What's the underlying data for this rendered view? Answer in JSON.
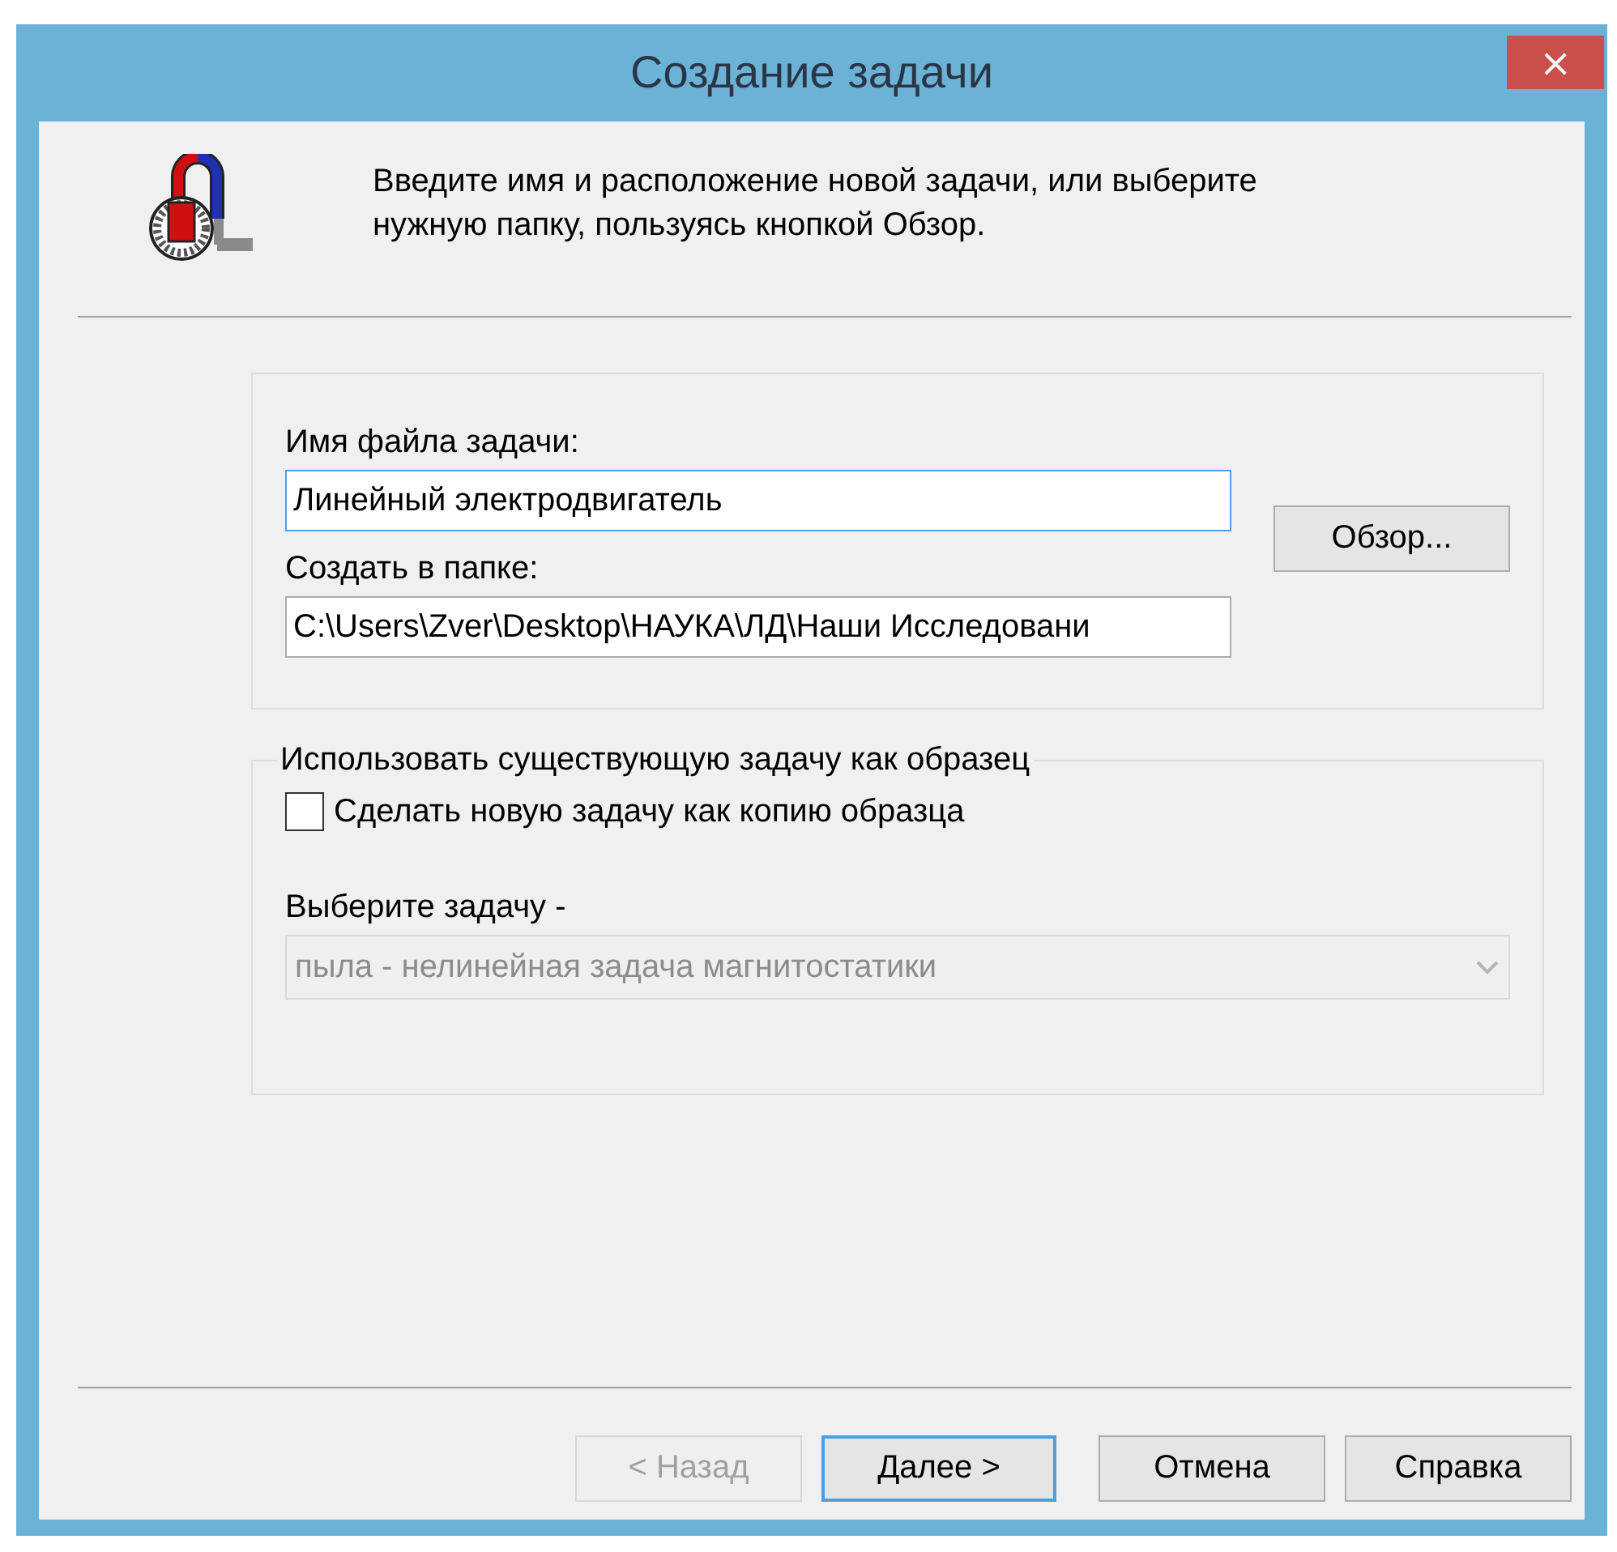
{
  "window": {
    "title": "Создание задачи",
    "close": "×"
  },
  "intro": "Введите имя и расположение новой задачи, или выберите нужную папку, пользуясь кнопкой Обзор.",
  "location": {
    "name_label": "Имя файла задачи:",
    "name_value": "Линейный электродвигатель",
    "name_focused": true,
    "folder_label": "Создать в папке:",
    "folder_value": "C:\\Users\\Zver\\Desktop\\НАУКА\\ЛД\\Наши Исследовани",
    "browse": "Обзор..."
  },
  "template": {
    "legend": "Использовать существующую задачу как образец",
    "checkbox": {
      "label": "Сделать новую задачу как копию образца",
      "checked": false
    },
    "select_label": "Выберите задачу -",
    "select": {
      "value": "пыла - нелинейная задача магнитостатики",
      "disabled": true
    }
  },
  "buttons": [
    {
      "label": "< Назад",
      "disabled": true,
      "default": false
    },
    {
      "label": "Далее >",
      "disabled": false,
      "default": true
    },
    {
      "label": "Отмена",
      "disabled": false,
      "default": false
    },
    {
      "label": "Справка",
      "disabled": false,
      "default": false
    }
  ]
}
